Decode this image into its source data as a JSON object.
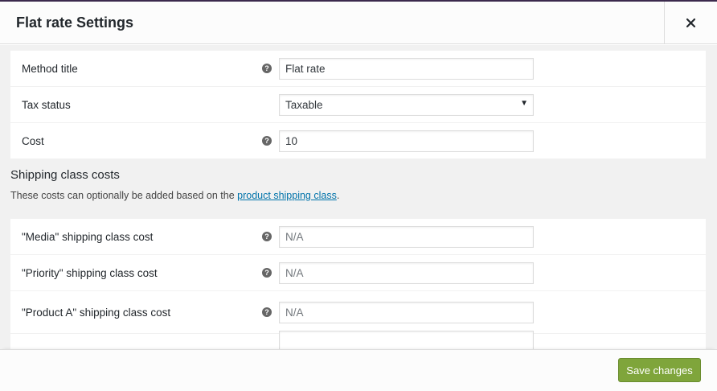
{
  "modal": {
    "title": "Flat rate Settings",
    "close_icon": "close-icon"
  },
  "general_settings": [
    {
      "label": "Method title",
      "help": true,
      "type": "text",
      "value": "Flat rate",
      "placeholder": ""
    },
    {
      "label": "Tax status",
      "help": false,
      "type": "select",
      "value": "Taxable"
    },
    {
      "label": "Cost",
      "help": true,
      "type": "text",
      "value": "10",
      "placeholder": ""
    }
  ],
  "shipping_classes": {
    "heading": "Shipping class costs",
    "description_prefix": "These costs can optionally be added based on the ",
    "link_text": "product shipping class",
    "description_suffix": ".",
    "rows": [
      {
        "label": "\"Media\" shipping class cost",
        "value": "",
        "placeholder": "N/A"
      },
      {
        "label": "\"Priority\" shipping class cost",
        "value": "",
        "placeholder": "N/A"
      },
      {
        "label": "\"Product A\" shipping class cost",
        "value": "",
        "placeholder": "N/A"
      }
    ]
  },
  "help_icon_glyph": "?",
  "select_caret": "▼",
  "footer": {
    "save_label": "Save changes"
  },
  "colors": {
    "accent_top": "#3c2a4d",
    "save_button": "#7fa53b",
    "link": "#0073aa"
  }
}
